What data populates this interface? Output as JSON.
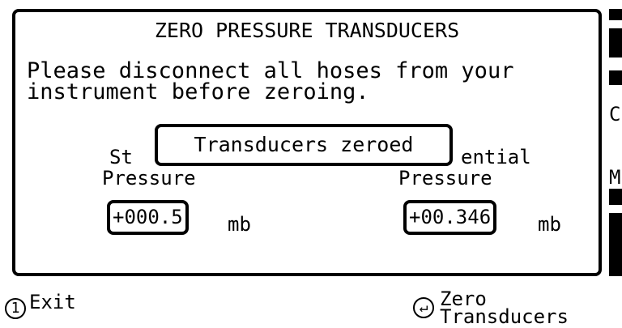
{
  "dialog": {
    "title": "ZERO PRESSURE TRANSDUCERS",
    "message": "Please disconnect all hoses from your\ninstrument before zeroing.",
    "static": {
      "label_line1_partial": "St",
      "label_line2": "Pressure",
      "value": "+000.5",
      "unit": "mb"
    },
    "differential": {
      "label_line1_partial": "ential",
      "label_line2": "Pressure",
      "value": "+00.346",
      "unit": "mb"
    },
    "popup": "Transducers zeroed"
  },
  "side_panel": {
    "chars": [
      "C",
      "M"
    ]
  },
  "footer": {
    "exit_key": "1",
    "exit_label": "Exit",
    "zero_key": "↵",
    "zero_label_line1": "Zero",
    "zero_label_line2": "Transducers"
  }
}
